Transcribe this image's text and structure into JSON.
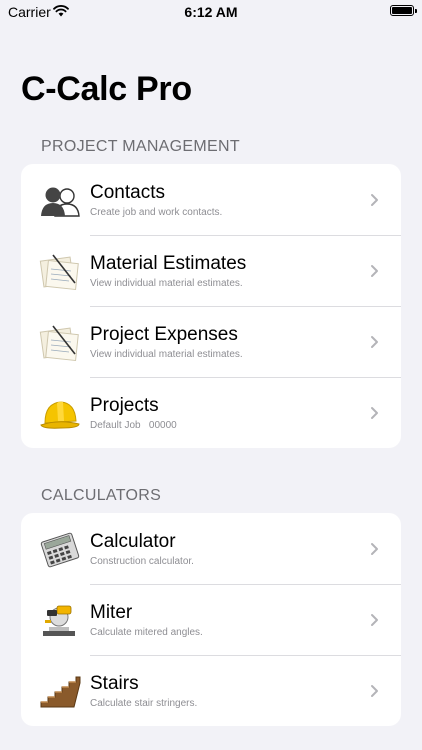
{
  "status": {
    "carrier": "Carrier",
    "time": "6:12 AM"
  },
  "app_title": "C-Calc Pro",
  "sections": [
    {
      "header": "PROJECT MANAGEMENT",
      "items": [
        {
          "title": "Contacts",
          "subtitle": "Create job and work contacts.",
          "icon": "contacts-icon"
        },
        {
          "title": "Material Estimates",
          "subtitle": "View individual material estimates.",
          "icon": "notepad-icon"
        },
        {
          "title": "Project Expenses",
          "subtitle": "View individual material estimates.",
          "icon": "notepad-icon"
        },
        {
          "title": "Projects",
          "subtitle": "Default Job   00000",
          "icon": "hard-hat-icon"
        }
      ]
    },
    {
      "header": "CALCULATORS",
      "items": [
        {
          "title": "Calculator",
          "subtitle": "Construction calculator.",
          "icon": "calculator-icon"
        },
        {
          "title": "Miter",
          "subtitle": "Calculate mitered angles.",
          "icon": "miter-saw-icon"
        },
        {
          "title": "Stairs",
          "subtitle": "Calculate stair stringers.",
          "icon": "stairs-icon"
        }
      ]
    }
  ],
  "colors": {
    "background": "#f2f2f7",
    "card": "#ffffff",
    "secondary_text": "#8e8e93",
    "section_header": "#6d6d72",
    "hard_hat": "#f5c400"
  }
}
